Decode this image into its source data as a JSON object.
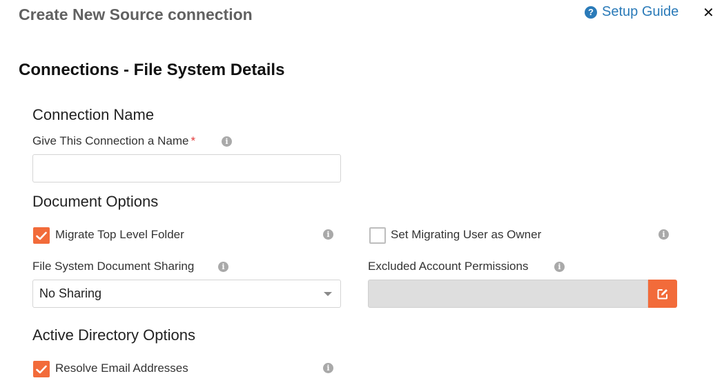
{
  "header": {
    "title": "Create New Source connection",
    "setup_guide_label": "Setup Guide",
    "close_glyph": "✕"
  },
  "section": {
    "title": "Connections - File System Details"
  },
  "connection_name": {
    "group_title": "Connection Name",
    "name_label": "Give This Connection a Name",
    "required_mark": "*",
    "name_value": ""
  },
  "document_options": {
    "group_title": "Document Options",
    "migrate_top_level_folder": {
      "label": "Migrate Top Level Folder",
      "checked": true
    },
    "set_migrating_user_as_owner": {
      "label": "Set Migrating User as Owner",
      "checked": false
    },
    "sharing_label": "File System Document Sharing",
    "sharing_value": "No Sharing",
    "excluded_label": "Excluded Account Permissions",
    "excluded_value": ""
  },
  "active_directory_options": {
    "group_title": "Active Directory Options",
    "resolve_email_addresses": {
      "label": "Resolve Email Addresses",
      "checked": true
    }
  },
  "icons": {
    "info": "i",
    "help": "?",
    "check": "check-icon",
    "edit": "edit-icon"
  },
  "colors": {
    "accent": "#f26b3a",
    "link": "#2a7ab8",
    "required": "#e23b3b",
    "info_gray": "#a9a9a9"
  }
}
